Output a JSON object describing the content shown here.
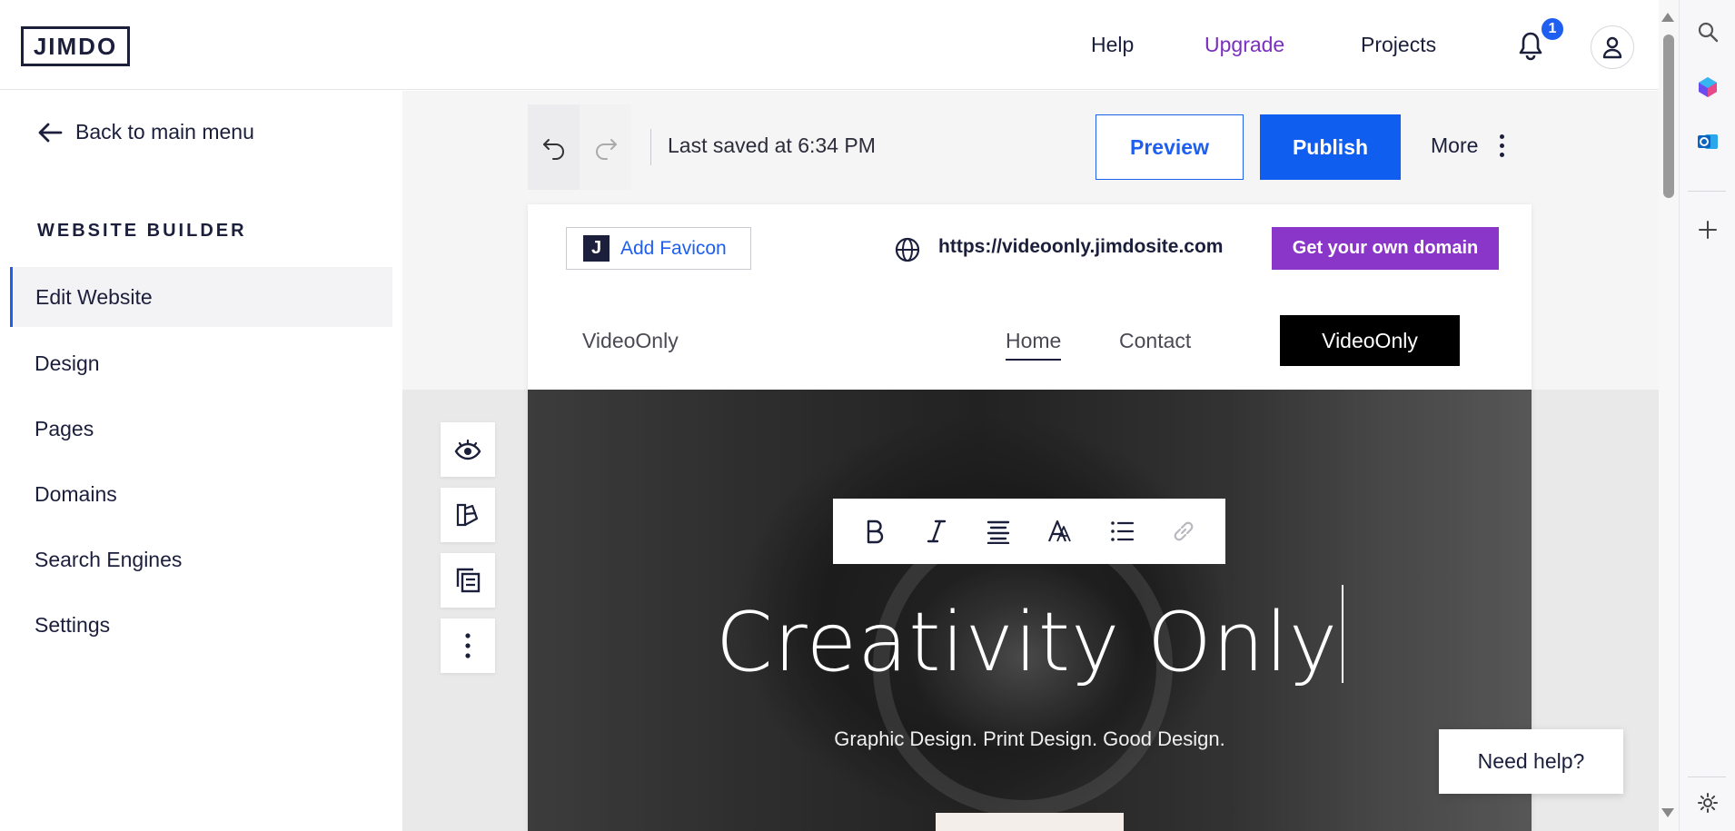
{
  "app": {
    "logo": "JIMDO",
    "nav": {
      "help": "Help",
      "upgrade": "Upgrade",
      "projects": "Projects"
    },
    "notifications_count": "1",
    "colors": {
      "accent": "#1e5ef0",
      "upgrade": "#7b2fbe",
      "domain": "#8a36c8"
    }
  },
  "sidebar": {
    "back_label": "Back to main menu",
    "section_title": "WEBSITE BUILDER",
    "items": [
      {
        "label": "Edit Website",
        "active": true
      },
      {
        "label": "Design"
      },
      {
        "label": "Pages"
      },
      {
        "label": "Domains"
      },
      {
        "label": "Search Engines"
      },
      {
        "label": "Settings"
      }
    ]
  },
  "editor": {
    "last_saved": "Last saved at 6:34 PM",
    "preview_label": "Preview",
    "publish_label": "Publish",
    "more_label": "More"
  },
  "site": {
    "favicon_label": "Add Favicon",
    "favicon_letter": "J",
    "url": "https://videoonly.jimdosite.com",
    "domain_button": "Get your own domain",
    "brand": "VideoOnly",
    "nav": {
      "home": "Home",
      "contact": "Contact"
    },
    "cta": "VideoOnly",
    "hero": {
      "title": "Creativity Only",
      "subtitle": "Graphic Design. Print Design. Good Design."
    },
    "format_bar": [
      "bold-icon",
      "italic-icon",
      "align-center-icon",
      "text-style-icon",
      "list-icon",
      "link-icon"
    ]
  },
  "help": {
    "label": "Need help?"
  }
}
